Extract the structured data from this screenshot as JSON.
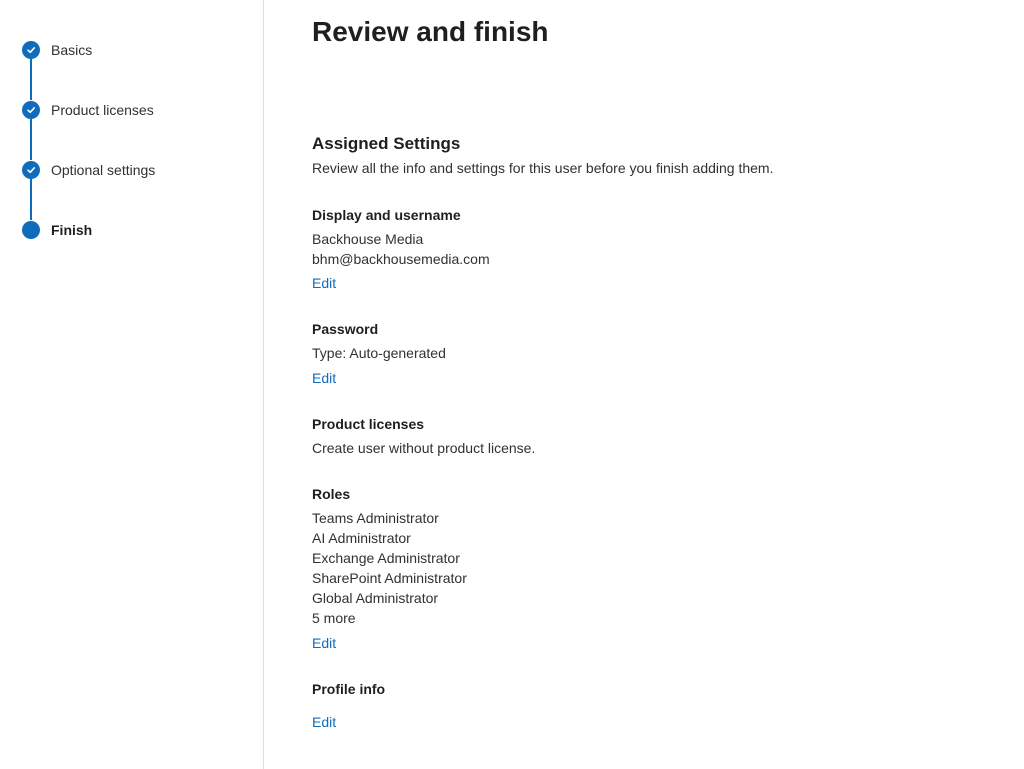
{
  "stepper": {
    "steps": [
      {
        "label": "Basics",
        "state": "completed"
      },
      {
        "label": "Product licenses",
        "state": "completed"
      },
      {
        "label": "Optional settings",
        "state": "completed"
      },
      {
        "label": "Finish",
        "state": "current"
      }
    ]
  },
  "main": {
    "title": "Review and finish",
    "section_title": "Assigned Settings",
    "description": "Review all the info and settings for this user before you finish adding them.",
    "display": {
      "label": "Display and username",
      "name": "Backhouse Media",
      "email": "bhm@backhousemedia.com",
      "edit": "Edit"
    },
    "password": {
      "label": "Password",
      "type": "Type: Auto-generated",
      "edit": "Edit"
    },
    "licenses": {
      "label": "Product licenses",
      "value": "Create user without product license."
    },
    "roles": {
      "label": "Roles",
      "items": [
        "Teams Administrator",
        "AI Administrator",
        "Exchange Administrator",
        "SharePoint Administrator",
        "Global Administrator"
      ],
      "more": "5 more",
      "edit": "Edit"
    },
    "profile": {
      "label": "Profile info",
      "edit": "Edit"
    }
  },
  "colors": {
    "accent": "#0f6cbd",
    "text": "#323130",
    "divider": "#e1dfdd"
  }
}
